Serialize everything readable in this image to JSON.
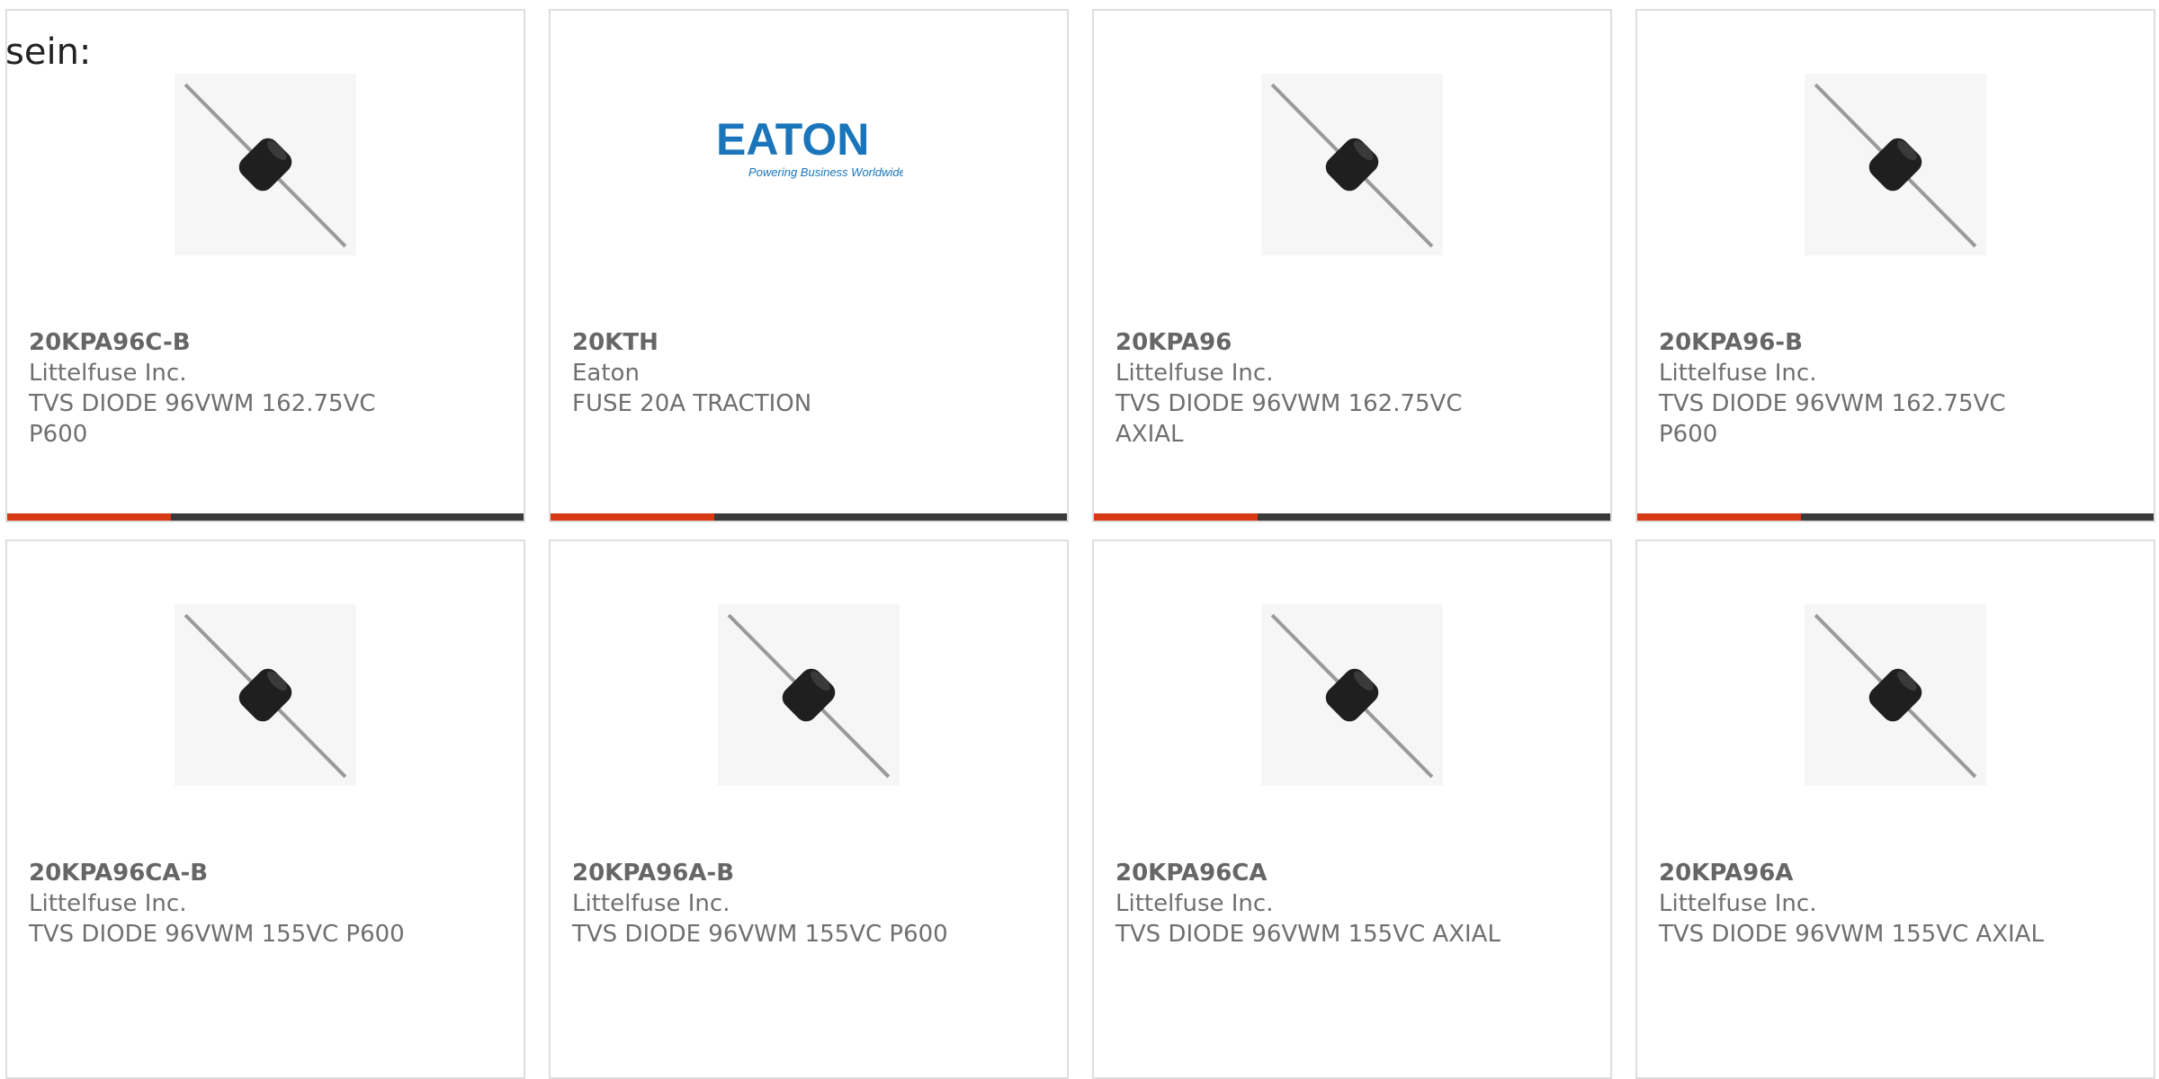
{
  "intro_text": "sein:",
  "colors": {
    "accent": "#d83a14",
    "bar": "#3a3a3a",
    "border": "#dedede",
    "eaton_blue": "#1a75bb"
  },
  "products": [
    {
      "part_number": "20KPA96C-B",
      "manufacturer": "Littelfuse Inc.",
      "description": "TVS DIODE 96VWM 162.75VC P600",
      "image": "axial-diode-icon"
    },
    {
      "part_number": "20KTH",
      "manufacturer": "Eaton",
      "description": "FUSE 20A TRACTION",
      "image": "eaton-logo",
      "logo_text": "EATON",
      "logo_tagline": "Powering Business Worldwide"
    },
    {
      "part_number": "20KPA96",
      "manufacturer": "Littelfuse Inc.",
      "description": "TVS DIODE 96VWM 162.75VC AXIAL",
      "image": "axial-diode-icon"
    },
    {
      "part_number": "20KPA96-B",
      "manufacturer": "Littelfuse Inc.",
      "description": "TVS DIODE 96VWM 162.75VC P600",
      "image": "axial-diode-icon"
    },
    {
      "part_number": "20KPA96CA-B",
      "manufacturer": "Littelfuse Inc.",
      "description": "TVS DIODE 96VWM 155VC P600",
      "image": "axial-diode-icon"
    },
    {
      "part_number": "20KPA96A-B",
      "manufacturer": "Littelfuse Inc.",
      "description": "TVS DIODE 96VWM 155VC P600",
      "image": "axial-diode-icon"
    },
    {
      "part_number": "20KPA96CA",
      "manufacturer": "Littelfuse Inc.",
      "description": "TVS DIODE 96VWM 155VC AXIAL",
      "image": "axial-diode-icon"
    },
    {
      "part_number": "20KPA96A",
      "manufacturer": "Littelfuse Inc.",
      "description": "TVS DIODE 96VWM 155VC AXIAL",
      "image": "axial-diode-icon"
    }
  ]
}
